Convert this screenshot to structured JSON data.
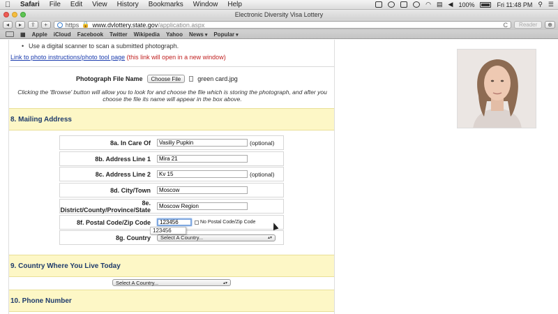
{
  "menubar": {
    "apple": "",
    "app": "Safari",
    "items": [
      "File",
      "Edit",
      "View",
      "History",
      "Bookmarks",
      "Window",
      "Help"
    ],
    "battery": "100%",
    "clock": "Fri 11:48 PM"
  },
  "window": {
    "title": "Electronic Diversity Visa Lottery"
  },
  "toolbar": {
    "back": "◂",
    "forward": "▸",
    "share": "⇪",
    "add": "+",
    "url_scheme": "https",
    "url_host": "www.dvlottery.state.gov",
    "url_path": "/application.aspx",
    "reload": "C",
    "reader": "Reader"
  },
  "bookmarks": {
    "items": [
      "Apple",
      "iCloud",
      "Facebook",
      "Twitter",
      "Wikipedia",
      "Yahoo",
      "News",
      "Popular"
    ]
  },
  "photo_section": {
    "bullet": "Use a digital scanner to scan a submitted photograph.",
    "link": "Link to photo instructions/photo tool page",
    "link_note": " (this link will open in a new window)",
    "file_label": "Photograph File Name",
    "choose_button": "Choose File",
    "file_name": "green card.jpg",
    "note": "Clicking the 'Browse' button will allow you to look for and choose the file which is storing the photograph, and after you choose the file its name will appear in the box above."
  },
  "mailing": {
    "title": "8. Mailing Address",
    "fields": [
      {
        "label": "8a. In Care Of",
        "value": "Vasiliy Pupkin",
        "optional": "(optional)"
      },
      {
        "label": "8b. Address Line 1",
        "value": "Mira 21",
        "optional": ""
      },
      {
        "label": "8c. Address Line 2",
        "value": "Kv 15",
        "optional": "(optional)"
      },
      {
        "label": "8d. City/Town",
        "value": "Moscow",
        "optional": ""
      },
      {
        "label": "8e. District/County/Province/State",
        "value": "Moscow Region",
        "optional": ""
      }
    ],
    "postal": {
      "label": "8f. Postal Code/Zip Code",
      "value": "123456",
      "no_postal": "No Postal Code/Zip Code",
      "suggestion": "123456"
    },
    "country": {
      "label": "8g. Country",
      "selected": "Select A Country..."
    }
  },
  "country_live": {
    "title": "9. Country Where You Live Today",
    "selected": "Select A Country..."
  },
  "phone": {
    "title": "10. Phone Number"
  }
}
